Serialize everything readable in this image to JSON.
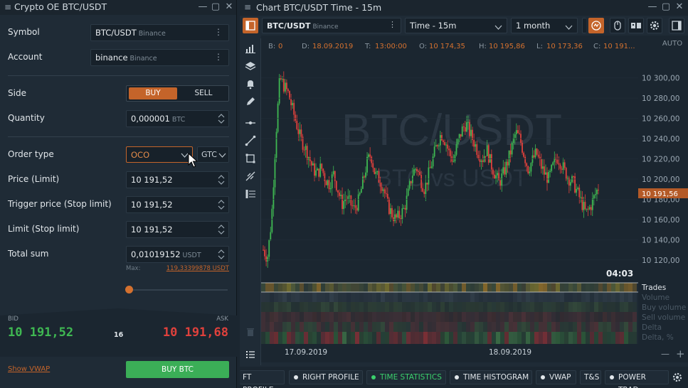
{
  "left_panel": {
    "title": "Crypto OE BTC/USDT",
    "symbol_label": "Symbol",
    "symbol_value": "BTC/USDT",
    "symbol_exchange": "Binance",
    "account_label": "Account",
    "account_value": "binance",
    "account_exchange": "Binance",
    "side_label": "Side",
    "buy_label": "BUY",
    "sell_label": "SELL",
    "quantity_label": "Quantity",
    "quantity_value": "0,000001",
    "quantity_unit": "BTC",
    "order_type_label": "Order type",
    "order_type_value": "OCO",
    "tif_value": "GTC",
    "price_label": "Price (Limit)",
    "price_value": "10 191,52",
    "trigger_label": "Trigger price (Stop limit)",
    "trigger_value": "10 191,52",
    "limit_label": "Limit (Stop limit)",
    "limit_value": "10 191,52",
    "total_label": "Total sum",
    "total_value": "0,01019152",
    "total_unit": "USDT",
    "max_label": "Max:",
    "max_value": "119,33399878 USDT",
    "bid_label": "BID",
    "ask_label": "ASK",
    "bid_value": "10 191,52",
    "ask_value": "10 191,68",
    "spread_value": "16",
    "vwap_link": "Show VWAP",
    "buy_button": "BUY BTC",
    "colors": {
      "accent": "#c4642a",
      "bid": "#3fb852",
      "ask": "#e0413c",
      "buy_button": "#3bae57"
    }
  },
  "chart_panel": {
    "title": "Chart BTC/USDT Time - 15m",
    "symbol_value": "BTC/USDT",
    "symbol_exchange": "Binance",
    "timeframe_value": "Time - 15m",
    "range_value": "1 month",
    "auto_label": "AUTO",
    "ohlc": {
      "b_label": "B:",
      "b_value": "0",
      "d_label": "D:",
      "d_value": "18.09.2019",
      "t_label": "T:",
      "t_value": "13:00:00",
      "o_label": "O:",
      "o_value": "10 174,35",
      "h_label": "H:",
      "h_value": "10 195,86",
      "l_label": "L:",
      "l_value": "10 173,36",
      "c_label": "C:",
      "c_value": "10 191..."
    },
    "watermark_main": "BTC/USDT",
    "watermark_sub": "BTC vs USDT",
    "price_ticks": [
      "10 300,00",
      "10 280,00",
      "10 260,00",
      "10 240,00",
      "10 220,00",
      "10 200,00",
      "10 180,00",
      "10 160,00",
      "10 140,00",
      "10 120,00"
    ],
    "current_price": "10 191,56",
    "countdown": "04:03",
    "date_ticks": [
      "17.09.2019",
      "18.09.2019"
    ],
    "indicator_labels": [
      "Trades",
      "Volume",
      "Buy volume",
      "Sell volume",
      "Delta",
      "Delta, %"
    ],
    "zoom_out": "—",
    "zoom_in": "+"
  },
  "bottom_tabs": [
    {
      "label": "FT PROFILE",
      "active": false
    },
    {
      "label": "RIGHT PROFILE",
      "active": false
    },
    {
      "label": "TIME STATISTICS",
      "active": true
    },
    {
      "label": "TIME HISTOGRAM",
      "active": false
    },
    {
      "label": "VWAP",
      "active": false
    },
    {
      "label": "T&S",
      "active": false
    },
    {
      "label": "POWER TRAD",
      "active": false
    }
  ],
  "chart_data": {
    "type": "candlestick",
    "x_ticks": [
      "17.09.2019",
      "18.09.2019"
    ],
    "y_ticks": [
      10120,
      10140,
      10160,
      10180,
      10200,
      10220,
      10240,
      10260,
      10280,
      10300
    ],
    "ylim": [
      10110,
      10325
    ],
    "close_series": [
      10130,
      10122,
      10160,
      10240,
      10300,
      10292,
      10285,
      10270,
      10255,
      10240,
      10232,
      10222,
      10210,
      10205,
      10212,
      10200,
      10195,
      10205,
      10190,
      10175,
      10182,
      10176,
      10170,
      10178,
      10195,
      10215,
      10225,
      10205,
      10200,
      10192,
      10175,
      10166,
      10160,
      10164,
      10170,
      10185,
      10205,
      10212,
      10200,
      10190,
      10205,
      10220,
      10235,
      10245,
      10238,
      10225,
      10218,
      10236,
      10248,
      10255,
      10245,
      10236,
      10226,
      10220,
      10230,
      10215,
      10205,
      10196,
      10205,
      10216,
      10230,
      10246,
      10240,
      10225,
      10210,
      10218,
      10226,
      10214,
      10205,
      10200,
      10212,
      10222,
      10216,
      10206,
      10200,
      10196,
      10186,
      10176,
      10166,
      10172,
      10182,
      10192
    ],
    "current_price": 10191.56
  }
}
